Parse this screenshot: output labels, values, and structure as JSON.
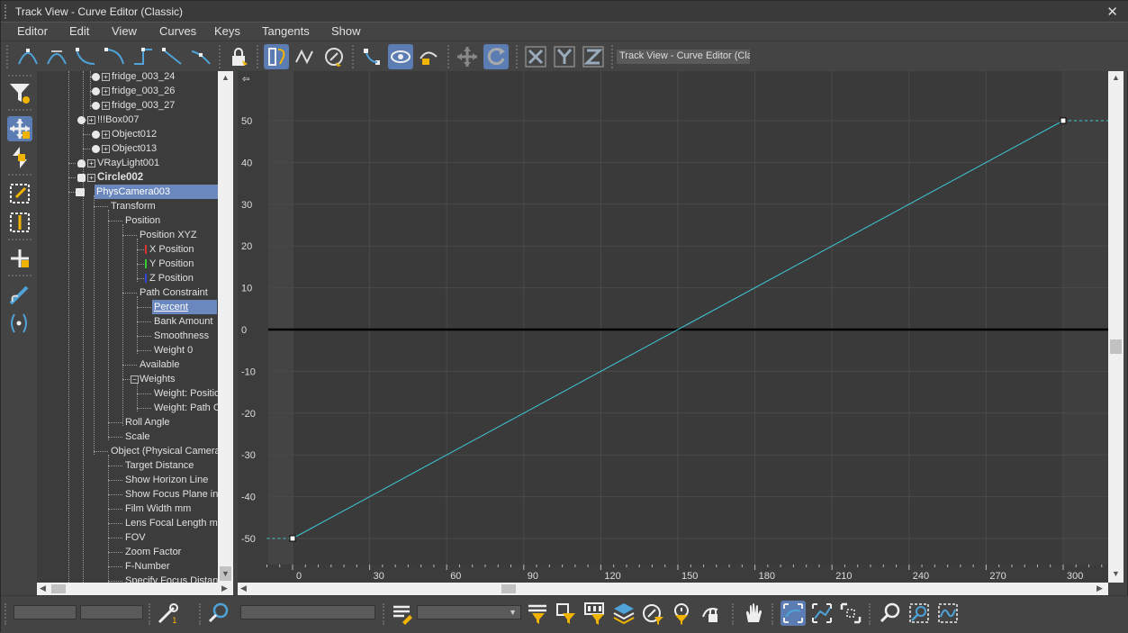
{
  "window": {
    "title": "Track View - Curve Editor (Classic)",
    "close": "✕"
  },
  "menu": [
    "Editor",
    "Edit",
    "View",
    "Curves",
    "Keys",
    "Tangents",
    "Show"
  ],
  "toolbar": {
    "label": "Track View - Curve Editor (Classic)"
  },
  "tree": {
    "items": [
      "fridge_003_24",
      "fridge_003_26",
      "fridge_003_27",
      "!!!Box007",
      "Object012",
      "Object013",
      "VRayLight001",
      "Circle002",
      "PhysCamera003",
      "Transform",
      "Position",
      "Position XYZ",
      "X Position",
      "Y Position",
      "Z Position",
      "Path Constraint",
      "Percent",
      "Bank Amount",
      "Smoothness",
      "Weight 0",
      "Available",
      "Weights",
      "Weight: Position",
      "Weight: Path Constraint",
      "Roll Angle",
      "Scale",
      "Object (Physical Camera)",
      "Target Distance",
      "Show Horizon Line",
      "Show Focus Plane in Camera",
      "Film Width mm",
      "Lens Focal Length mm",
      "FOV",
      "Zoom Factor",
      "F-Number",
      "Specify Focus Distance"
    ]
  },
  "chart_data": {
    "type": "line",
    "xlabel": "",
    "ylabel": "",
    "x_ticks": [
      0,
      30,
      60,
      90,
      120,
      150,
      180,
      210,
      240,
      270,
      300
    ],
    "y_ticks": [
      50,
      40,
      30,
      20,
      10,
      0,
      -10,
      -20,
      -30,
      -40,
      -50
    ],
    "xlim": [
      -10,
      320
    ],
    "ylim": [
      -55,
      60
    ],
    "grid": true,
    "series": [
      {
        "x": [
          0,
          300
        ],
        "values": [
          -50,
          50
        ],
        "color": "#3fc8d8"
      }
    ],
    "keys": [
      {
        "x": 0,
        "y": -50
      },
      {
        "x": 300,
        "y": 50
      }
    ],
    "out_of_range": [
      {
        "x": [
          -10,
          0
        ],
        "values": [
          -50,
          -50
        ]
      },
      {
        "x": [
          300,
          320
        ],
        "values": [
          50,
          50
        ]
      }
    ]
  }
}
